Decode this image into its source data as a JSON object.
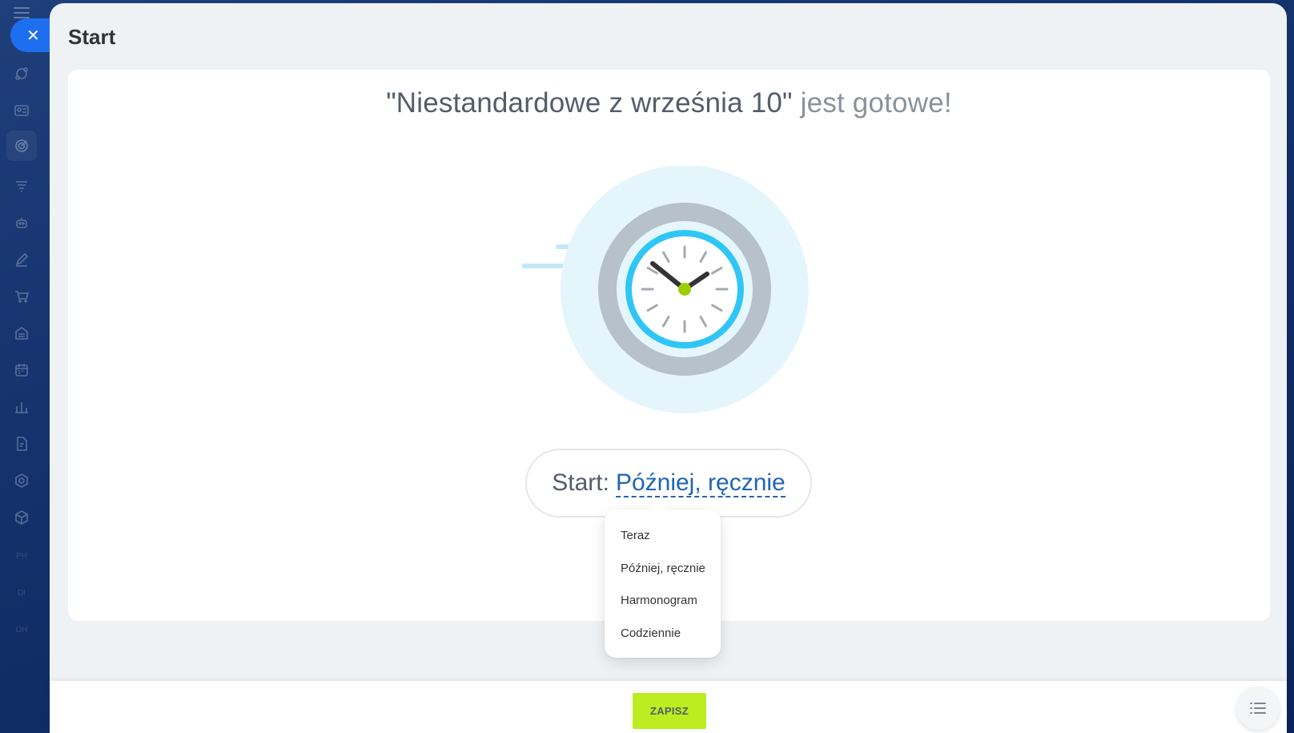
{
  "app": {
    "close_glyph": "✕",
    "nav_icons": [
      "crm-icon",
      "contact-card-icon",
      "target-icon",
      "funnel-icon",
      "robot-icon",
      "sign-icon",
      "shop-cart-icon",
      "store-icon",
      "calendar-icon",
      "analytics-icon",
      "documents-icon",
      "settings-icon",
      "package-icon"
    ],
    "nav_text_items": [
      "PH",
      "DI",
      "OH"
    ]
  },
  "panel": {
    "title": "Start"
  },
  "card": {
    "headline_strong": "\"Niestandardowe z września 10\"",
    "headline_light": "jest gotowe!",
    "start_label": "Start:",
    "start_value": "Później, ręcznie"
  },
  "dropdown": {
    "items": [
      "Teraz",
      "Później, ręcznie",
      "Harmonogram",
      "Codziennie"
    ],
    "selected": "Później, ręcznie"
  },
  "footer": {
    "save_label": "ZAPISZ"
  },
  "colors": {
    "accent_blue": "#1d6ff0",
    "link_blue": "#2066b0",
    "save_green": "#bbed21",
    "clock_ring": "#2fc6f6",
    "clock_center": "#9dcf00"
  }
}
